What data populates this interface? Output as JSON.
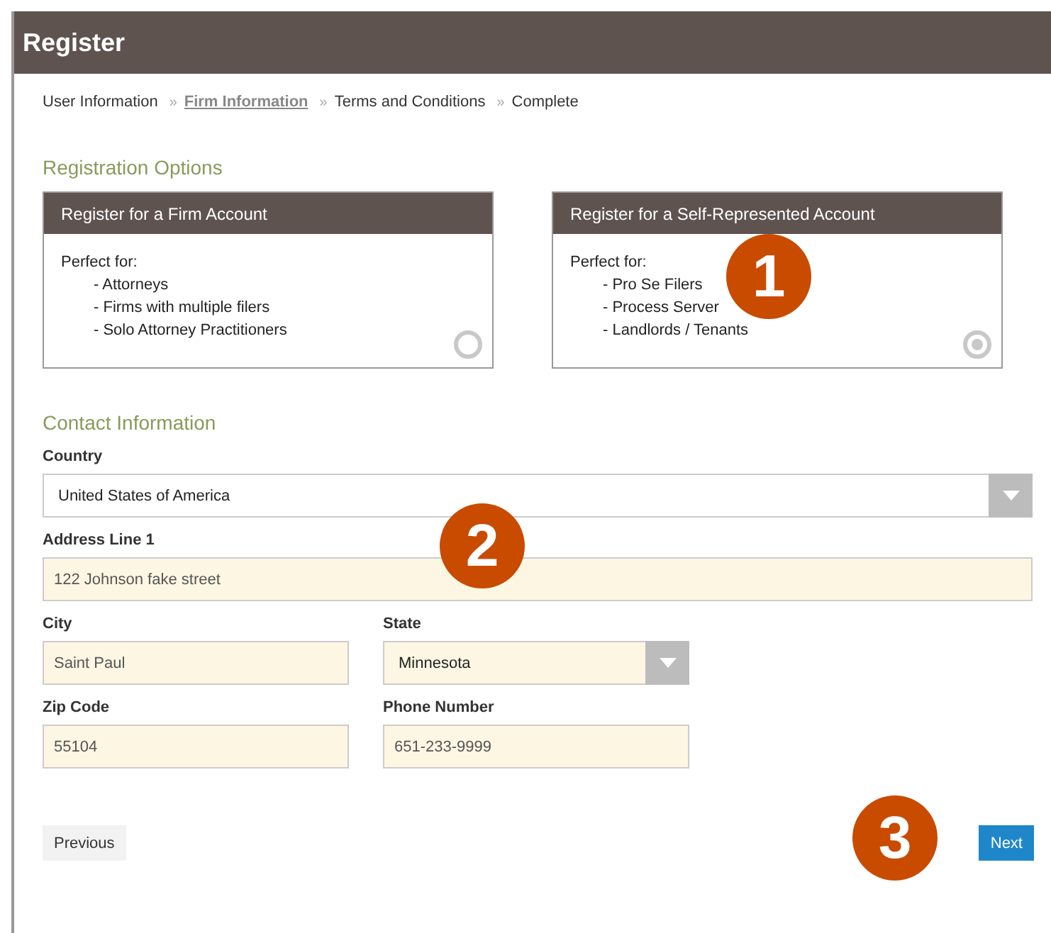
{
  "header": {
    "title": "Register"
  },
  "steps": [
    {
      "label": "User Information",
      "selected": false
    },
    {
      "prefix": "»",
      "label": "Firm Information",
      "selected": true
    },
    {
      "prefix": "»",
      "label": "Terms and Conditions",
      "selected": false
    },
    {
      "prefix": "»",
      "label": "Complete",
      "selected": false
    }
  ],
  "registration_options": {
    "heading": "Registration Options",
    "cards": [
      {
        "title": "Register for a Firm Account",
        "intro": "Perfect for:",
        "items": [
          "- Attorneys",
          "- Firms with multiple filers",
          "- Solo Attorney Practitioners"
        ],
        "selected": false
      },
      {
        "title": "Register for a Self-Represented Account",
        "intro": "Perfect for:",
        "items": [
          "- Pro Se Filers",
          "- Process Server",
          "- Landlords / Tenants"
        ],
        "selected": true
      }
    ]
  },
  "contact_information": {
    "heading": "Contact Information",
    "rows": [
      [
        {
          "label": "Country",
          "kind": "select",
          "value": "United States of America",
          "highlighted": false,
          "wide": true
        }
      ],
      [
        {
          "label": "Address Line 1",
          "kind": "text",
          "value": "122 Johnson fake street",
          "highlighted": true,
          "wide": true
        }
      ],
      [
        {
          "label": "City",
          "kind": "text",
          "value": "Saint Paul",
          "highlighted": true,
          "wide": false
        },
        {
          "label": "State",
          "kind": "select",
          "value": "Minnesota",
          "highlighted": true,
          "wide": false
        }
      ],
      [
        {
          "label": "Zip Code",
          "kind": "text",
          "value": "55104",
          "highlighted": true,
          "wide": false
        },
        {
          "label": "Phone Number",
          "kind": "text",
          "value": "651-233-9999",
          "highlighted": true,
          "wide": false
        }
      ]
    ]
  },
  "buttons": {
    "previous": "Previous",
    "next": "Next"
  },
  "callouts": [
    "1",
    "2",
    "3"
  ]
}
